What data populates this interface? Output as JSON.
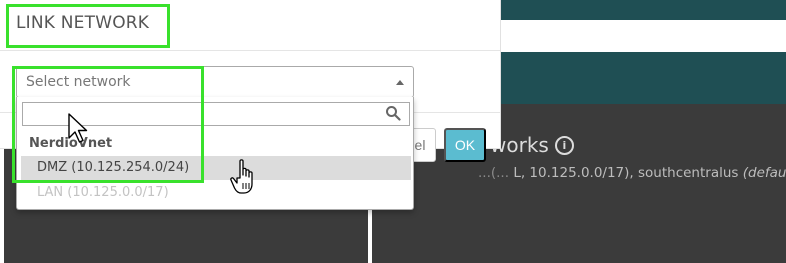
{
  "background": {
    "heading": "works",
    "subtitle_prefix": "...(...",
    "subtitle_region": "L, 10.125.0.0/17), southcentralus",
    "subtitle_default": "(default)"
  },
  "modal": {
    "title": "LINK NETWORK",
    "cancel_label": "el",
    "ok_label": "OK"
  },
  "select": {
    "placeholder": "Select network",
    "search_value": "",
    "group_label": "NerdioVnet",
    "options": [
      {
        "label": "DMZ (10.125.254.0/24)",
        "state": "highlighted"
      },
      {
        "label": "LAN (10.125.0.0/17)",
        "state": "disabled"
      }
    ]
  },
  "colors": {
    "highlight": "#39e12c",
    "ok_button": "#5bbcd0",
    "dark_band": "#1f4f54"
  }
}
